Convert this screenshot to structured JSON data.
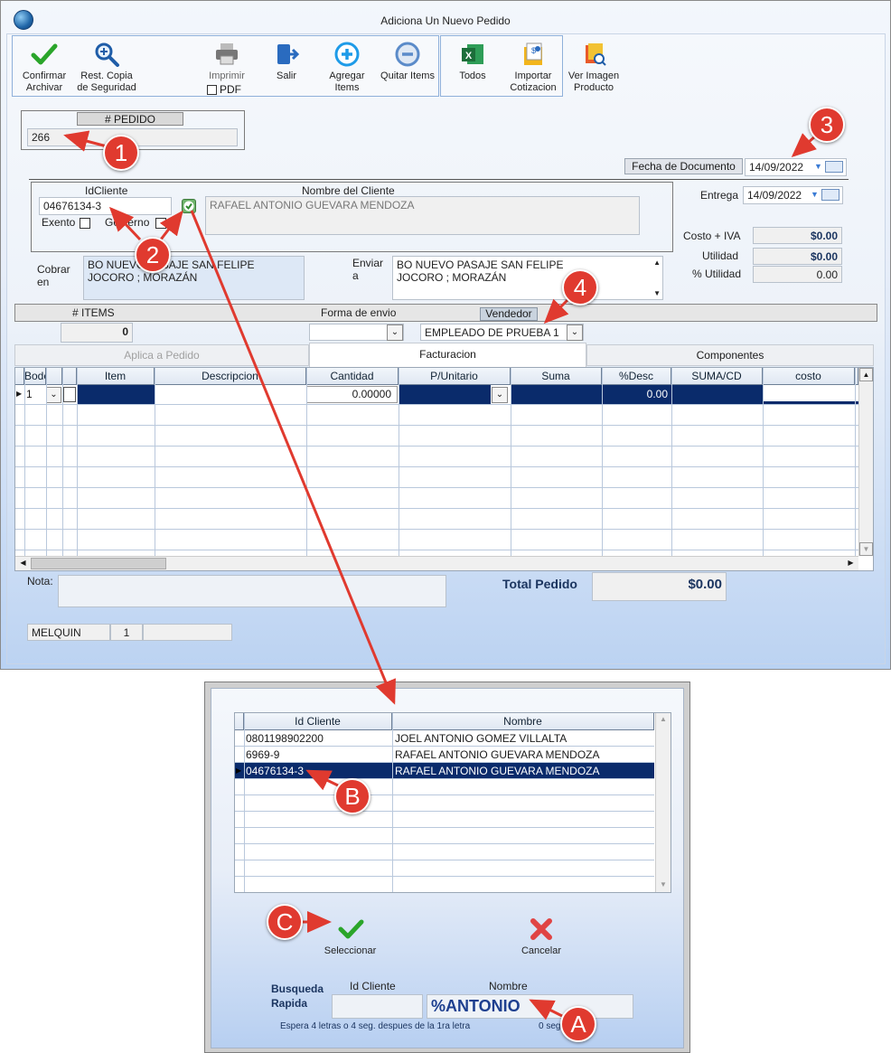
{
  "window": {
    "title": "Adiciona Un Nuevo Pedido"
  },
  "toolbar": {
    "confirm": "Confirmar Archivar",
    "restore": "Rest. Copia de Seguridad",
    "print": "Imprimir",
    "pdf": "PDF",
    "exit": "Salir",
    "add_items": "Agregar Items",
    "remove_items": "Quitar Items",
    "all": "Todos",
    "import": "Importar Cotizacion",
    "view_image": "Ver Imagen Producto"
  },
  "pedido": {
    "label": "# PEDIDO",
    "value": "266"
  },
  "fecha_documento": {
    "label": "Fecha de  Documento",
    "value": "14/09/2022"
  },
  "entrega": {
    "label": "Entrega",
    "value": "14/09/2022"
  },
  "cliente": {
    "id_label": "IdCliente",
    "id_value": "04676134-3",
    "name_label": "Nombre del Cliente",
    "name_value": "RAFAEL ANTONIO GUEVARA MENDOZA",
    "exento": "Exento",
    "gobierno": "Gobierno"
  },
  "totals": {
    "costo_iva_label": "Costo + IVA",
    "costo_iva": "$0.00",
    "utilidad_label": "Utilidad",
    "utilidad": "$0.00",
    "pct_utilidad_label": "% Utilidad",
    "pct_utilidad": "0.00"
  },
  "cobrar": {
    "label": "Cobrar en",
    "line1": "BO NUEVO PASAJE SAN FELIPE",
    "line2": "JOCORO ; MORAZÁN"
  },
  "enviar": {
    "label": "Enviar a",
    "line1": "BO NUEVO PASAJE SAN FELIPE",
    "line2": "JOCORO ; MORAZÁN"
  },
  "items_bar": {
    "items_label": "# ITEMS",
    "items_value": "0",
    "forma_envio": "Forma de envio",
    "vendedor_label": "Vendedor",
    "vendedor_value": "EMPLEADO DE PRUEBA 1"
  },
  "tabs": [
    "Aplica a Pedido",
    "Facturacion",
    "Componentes"
  ],
  "grid": {
    "columns": [
      "Bodega",
      "Item",
      "Descripcion",
      "Cantidad",
      "P/Unitario",
      "Suma",
      "%Desc",
      "SUMA/CD",
      "costo"
    ],
    "row1": {
      "bodega": "1",
      "cantidad": "0.00000",
      "desc": "0.00"
    }
  },
  "nota_label": "Nota:",
  "total_pedido": {
    "label": "Total Pedido",
    "value": "$0.00"
  },
  "status": {
    "user": "MELQUIN",
    "num": "1"
  },
  "dialog": {
    "columns": [
      "Id Cliente",
      "Nombre"
    ],
    "rows": [
      {
        "id": "0801198902200",
        "name": "JOEL ANTONIO GOMEZ VILLALTA"
      },
      {
        "id": "6969-9",
        "name": "RAFAEL ANTONIO GUEVARA MENDOZA"
      },
      {
        "id": "04676134-3",
        "name": "RAFAEL ANTONIO GUEVARA MENDOZA"
      }
    ],
    "select": "Seleccionar",
    "cancel": "Cancelar",
    "quick_search": "Busqueda Rapida",
    "id_label": "Id Cliente",
    "name_label": "Nombre",
    "search_value": "%ANTONIO",
    "hint": "Espera 4 letras o 4 seg. despues de la 1ra letra",
    "seconds": "0 seg"
  },
  "callouts": [
    "1",
    "2",
    "3",
    "4",
    "B",
    "C",
    "A"
  ],
  "colors": {
    "callout": "#e03a2f",
    "selection": "#0a2b6b",
    "grid_line": "#b9c8dc"
  }
}
